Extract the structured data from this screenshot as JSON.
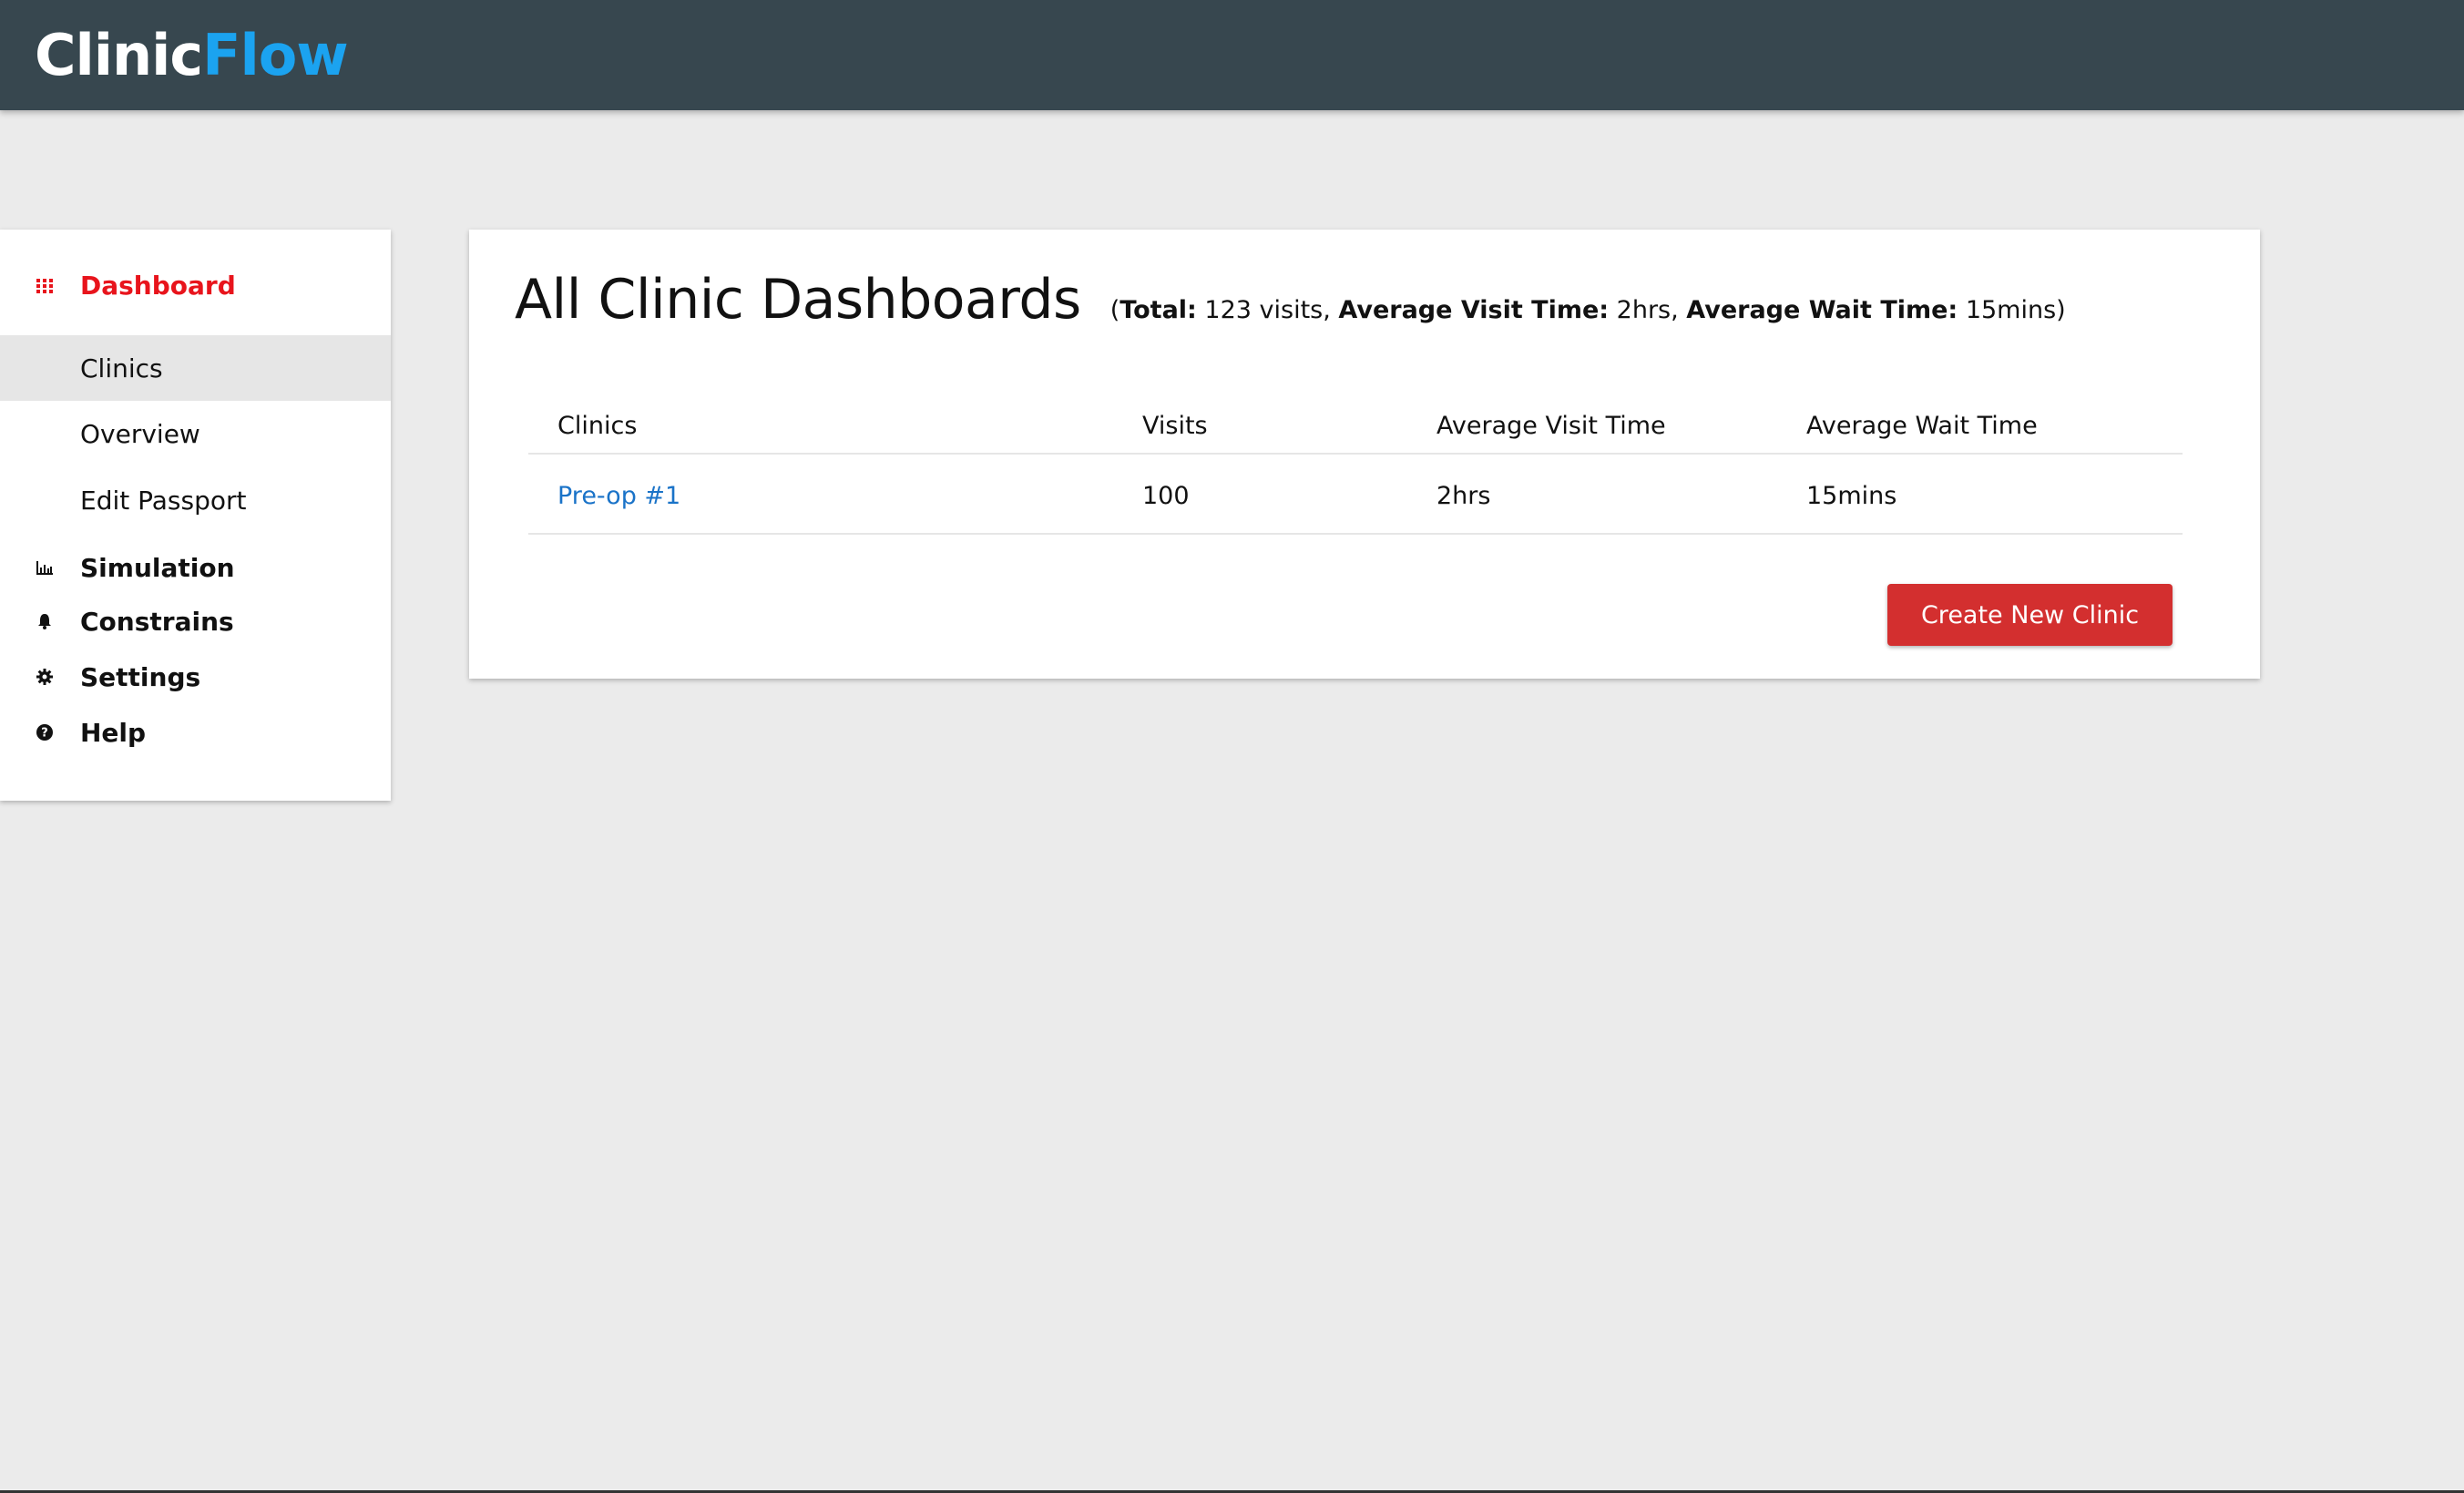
{
  "header": {
    "brand_part1": "Clinic",
    "brand_part2": "Flow",
    "brand_color_primary": "#ffffff",
    "brand_color_accent": "#1ba3f0",
    "background": "#37474f"
  },
  "sidebar": {
    "items": [
      {
        "label": "Dashboard",
        "icon": "grid-icon",
        "active": true
      },
      {
        "label": "Simulation",
        "icon": "bar-chart-icon"
      },
      {
        "label": "Constrains",
        "icon": "bell-icon"
      },
      {
        "label": "Settings",
        "icon": "gear-icon"
      },
      {
        "label": "Help",
        "icon": "help-circle-icon"
      }
    ],
    "subitems": [
      {
        "label": "Clinics",
        "selected": true
      },
      {
        "label": "Overview"
      },
      {
        "label": "Edit Passport"
      }
    ],
    "active_color": "#e8141c"
  },
  "main": {
    "title": "All Clinic Dashboards",
    "summary": {
      "open": "(",
      "total_label": "Total:",
      "total_value": " 123 visits, ",
      "avg_visit_label": "Average Visit Time:",
      "avg_visit_value": " 2hrs, ",
      "avg_wait_label": "Average Wait Time:",
      "avg_wait_value": " 15mins",
      "close": ")"
    },
    "table": {
      "headers": [
        "Clinics",
        "Visits",
        "Average Visit Time",
        "Average Wait Time"
      ],
      "rows": [
        [
          "Pre-op #1",
          "100",
          "2hrs",
          "15mins"
        ]
      ]
    },
    "create_button_label": "Create New Clinic",
    "button_color": "#d32f2f",
    "link_color": "#1a73c8"
  }
}
